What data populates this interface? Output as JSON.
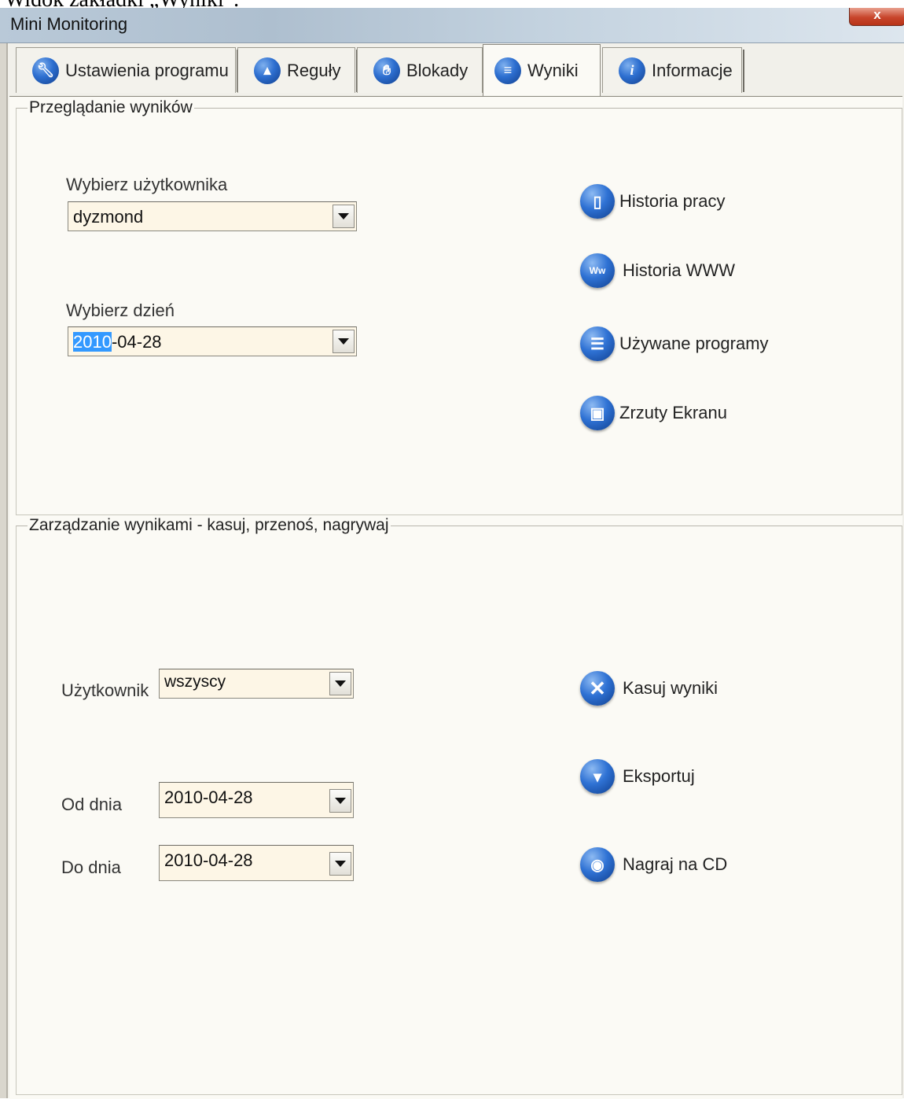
{
  "document_caption": "Widok zakładki „Wyniki”.",
  "window": {
    "title": "Mini Monitoring",
    "close_label": "x"
  },
  "tabs": [
    {
      "label": "Ustawienia programu",
      "icon": "wrench-icon",
      "active": false
    },
    {
      "label": "Reguły",
      "icon": "updown-arrows-icon",
      "active": false
    },
    {
      "label": "Blokady",
      "icon": "hand-stop-icon",
      "active": false
    },
    {
      "label": "Wyniki",
      "icon": "scroll-icon",
      "active": true
    },
    {
      "label": "Informacje",
      "icon": "info-icon",
      "active": false
    }
  ],
  "browse_group": {
    "legend": "Przeglądanie wyników",
    "user_label": "Wybierz użytkownika",
    "user_value": "dyzmond",
    "day_label": "Wybierz dzień",
    "day_value_selected": "2010",
    "day_value_rest": "-04-28",
    "actions": [
      {
        "label": "Historia pracy",
        "icon": "document-icon"
      },
      {
        "label": "Historia WWW",
        "icon": "www-icon"
      },
      {
        "label": "Używane programy",
        "icon": "list-icon"
      },
      {
        "label": "Zrzuty Ekranu",
        "icon": "screenshot-icon"
      }
    ]
  },
  "manage_group": {
    "legend": "Zarządzanie wynikami - kasuj, przenoś, nagrywaj",
    "user_label": "Użytkownik",
    "user_value": "wszyscy",
    "from_label": "Od dnia",
    "from_value": "2010-04-28",
    "to_label": "Do dnia",
    "to_value": "2010-04-28",
    "actions": [
      {
        "label": "Kasuj wyniki",
        "icon": "delete-x-icon"
      },
      {
        "label": "Eksportuj",
        "icon": "export-icon"
      },
      {
        "label": "Nagraj na CD",
        "icon": "cd-icon"
      }
    ]
  },
  "colors": {
    "accent_blue": "#2d6fd0",
    "selection": "#3399ff",
    "combo_bg": "#fdf6e6"
  }
}
